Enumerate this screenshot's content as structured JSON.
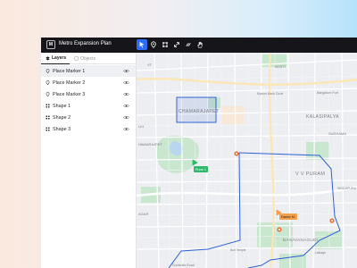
{
  "app": {
    "logo_text": "M",
    "project_name": "Metro Expansion Plan"
  },
  "toolbar": {
    "tools": [
      {
        "icon": "cursor-icon",
        "active": true
      },
      {
        "icon": "pin-icon",
        "active": false
      },
      {
        "icon": "shape-icon",
        "active": false
      },
      {
        "icon": "resize-icon",
        "active": false
      },
      {
        "icon": "path-icon",
        "active": false
      },
      {
        "icon": "hand-icon",
        "active": false
      }
    ]
  },
  "sidebar": {
    "tabs": [
      {
        "label": "Layers",
        "active": true
      },
      {
        "label": "Objects",
        "active": false
      }
    ],
    "layers": [
      {
        "label": "Place Marker 1",
        "type": "marker",
        "selected": true
      },
      {
        "label": "Place Marker 2",
        "type": "marker",
        "selected": false
      },
      {
        "label": "Place Marker 3",
        "type": "marker",
        "selected": false
      },
      {
        "label": "Shape 1",
        "type": "shape",
        "selected": false
      },
      {
        "label": "Shape 2",
        "type": "shape",
        "selected": false
      },
      {
        "label": "Shape 3",
        "type": "shape",
        "selected": false
      }
    ]
  },
  "map": {
    "labels": {
      "chamarajapet": "CHAMARAJAPET",
      "kalasipalya": "KALASIPALYA",
      "vv_puram": "V V PURAM",
      "basavanagudi": "BASAVANAGUDI",
      "bangalore_fort": "Bangalore Fort",
      "mysore_bank_circle": "Mysore Bank Circle",
      "siddapura": "SIDDAPURA",
      "lki": "LKI",
      "hamarajpet": "HAMARAJPET",
      "agar": "AGAR",
      "sudhama": "SUDHAMA",
      "bosti": "BOSTI",
      "vt": "VT",
      "dumbulla_road": "Dumbulla Road",
      "bull_temple": "Bull Temple",
      "lalbagh": "Lalbagh"
    },
    "markers": [
      {
        "label": "Pune 1"
      },
      {
        "label": "Dashv M."
      }
    ],
    "colors": {
      "route": "#2f62d6",
      "marker_green": "#2fb86a",
      "marker_orange": "#f5a04a",
      "pin_orange": "#e8743b"
    }
  }
}
